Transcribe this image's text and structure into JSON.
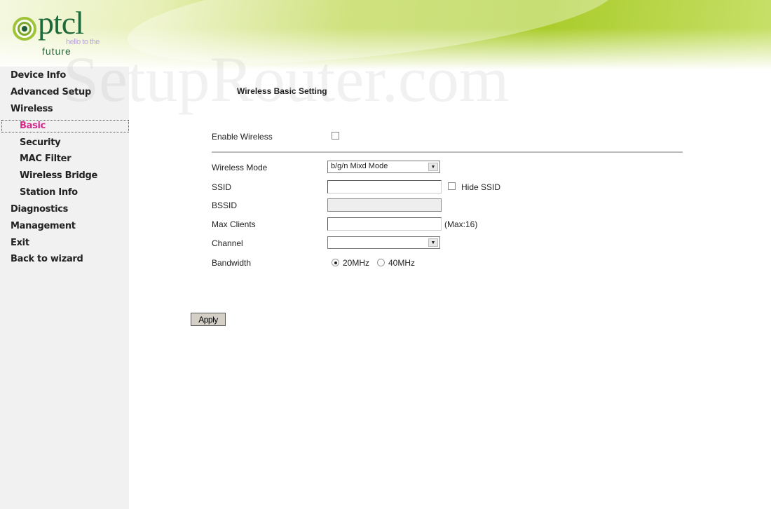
{
  "brand": {
    "logo_text": "ptcl",
    "tagline": "hello to the",
    "tagline2": "future",
    "colors": {
      "green": "#a9cc2a",
      "active": "#d62a8a"
    }
  },
  "watermark": "SetupRouter.com",
  "sidebar": {
    "items": [
      {
        "label": "Device Info"
      },
      {
        "label": "Advanced Setup"
      },
      {
        "label": "Wireless"
      },
      {
        "label": "Basic",
        "active": true
      },
      {
        "label": "Security"
      },
      {
        "label": "MAC Filter"
      },
      {
        "label": "Wireless Bridge"
      },
      {
        "label": "Station Info"
      },
      {
        "label": "Diagnostics"
      },
      {
        "label": "Management"
      },
      {
        "label": "Exit"
      },
      {
        "label": "Back to wizard"
      }
    ]
  },
  "main": {
    "title": "Wireless Basic Setting",
    "enable_wireless": {
      "label": "Enable Wireless",
      "checked": false
    },
    "wireless_mode": {
      "label": "Wireless Mode",
      "value": "b/g/n Mixd Mode"
    },
    "ssid": {
      "label": "SSID",
      "value": "",
      "hide_label": "Hide SSID",
      "hide_checked": false
    },
    "bssid": {
      "label": "BSSID",
      "value": ""
    },
    "max_clients": {
      "label": "Max Clients",
      "value": "",
      "hint": "(Max:16)"
    },
    "channel": {
      "label": "Channel",
      "value": ""
    },
    "bandwidth": {
      "label": "Bandwidth",
      "options": [
        "20MHz",
        "40MHz"
      ],
      "selected": "20MHz"
    },
    "apply_label": "Apply"
  }
}
